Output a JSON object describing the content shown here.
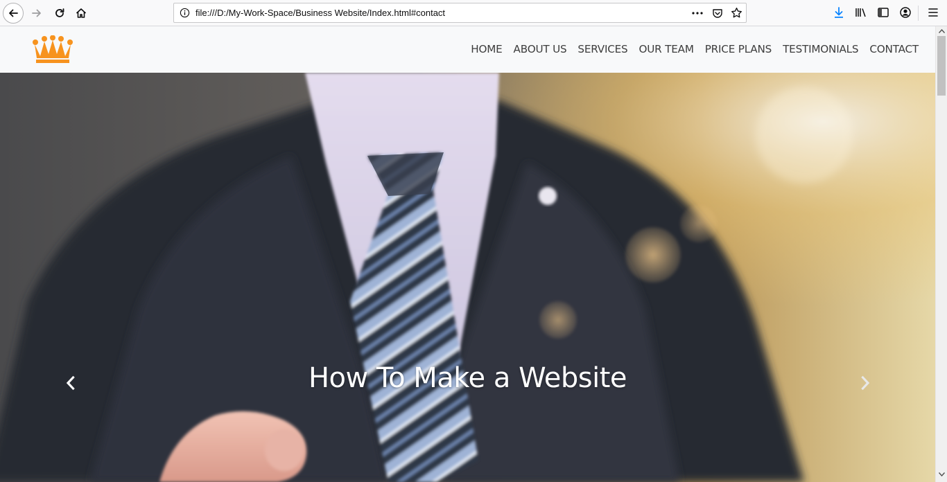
{
  "browser": {
    "url": "file:///D:/My-Work-Space/Business Website/Index.html#contact",
    "icons": [
      "back-icon",
      "forward-icon",
      "reload-icon",
      "home-icon",
      "info-icon",
      "page-actions-icon",
      "pocket-icon",
      "star-icon",
      "download-icon",
      "library-icon",
      "sidebar-icon",
      "account-icon",
      "menu-icon"
    ]
  },
  "site": {
    "logo_icon": "crown-icon",
    "accent_color": "#f7931e",
    "nav": {
      "items": [
        {
          "label": "HOME"
        },
        {
          "label": "ABOUT US"
        },
        {
          "label": "SERVICES"
        },
        {
          "label": "OUR TEAM"
        },
        {
          "label": "PRICE PLANS"
        },
        {
          "label": "TESTIMONIALS"
        },
        {
          "label": "CONTACT"
        }
      ]
    }
  },
  "carousel": {
    "caption": "How To Make a Website",
    "prev_icon": "chevron-left-icon",
    "next_icon": "chevron-right-icon"
  }
}
